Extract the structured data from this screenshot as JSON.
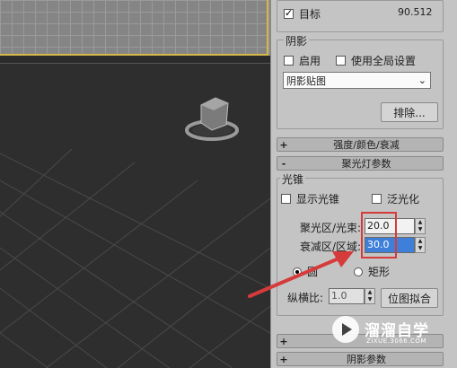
{
  "panel": {
    "target_label": "目标",
    "target_value": "90.512",
    "shadow_group_title": "阴影",
    "shadow_enable_label": "启用",
    "shadow_global_label": "使用全局设置",
    "shadow_map_value": "阴影贴图",
    "exclude_button": "排除...",
    "rollout_intensity": "强度/颜色/衰减",
    "rollout_spotlight_params": "聚光灯参数",
    "cone_group_title": "光锥",
    "show_cone_label": "显示光锥",
    "overshoot_label": "泛光化",
    "hotspot_label": "聚光区/光束:",
    "hotspot_value": "20.0",
    "falloff_label": "衰减区/区域:",
    "falloff_value": "30.0",
    "circle_label": "圆",
    "rectangle_label": "矩形",
    "aspect_label": "纵横比:",
    "aspect_value": "1.0",
    "bitmap_fit_button": "位图拟合",
    "rollout_bottom_1": "",
    "rollout_bottom_2": "阴影参数",
    "plus_sign": "+",
    "minus_sign": "-"
  },
  "watermark": {
    "brand": "溜溜自学",
    "url": "ZIXUE.3066.COM"
  },
  "colors": {
    "highlight": "#d63b3b",
    "arrow": "#d63b3b",
    "viewport_border": "#d9b84a",
    "panel_bg": "#c4c4c4"
  }
}
